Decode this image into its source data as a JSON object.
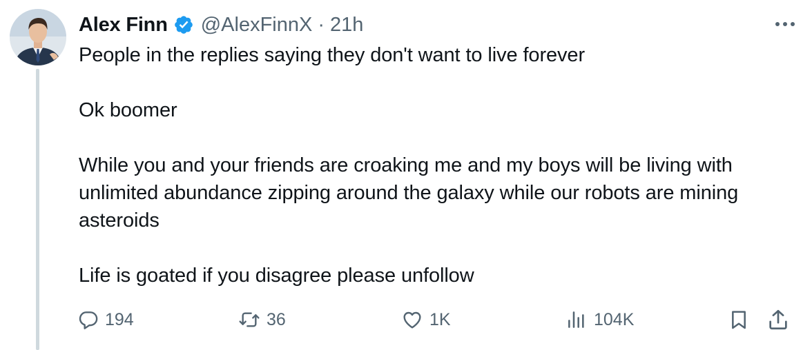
{
  "post": {
    "author": {
      "name": "Alex Finn",
      "handle": "@AlexFinnX",
      "avatar": "profile-photo",
      "verified": true,
      "verified_color": "#1d9bf0"
    },
    "separator": "·",
    "timestamp": "21h",
    "paragraphs": [
      "People in the replies saying they don't want to live forever",
      "Ok boomer",
      "While you and your friends are croaking me and my boys will be living with unlimited abundance zipping around the galaxy while our robots are mining asteroids",
      "Life is goated if you disagree please unfollow"
    ],
    "stats": {
      "replies": "194",
      "reposts": "36",
      "likes": "1K",
      "views": "104K"
    },
    "icons": {
      "more": "more-icon",
      "reply": "reply-icon",
      "repost": "repost-icon",
      "like": "heart-icon",
      "views": "views-icon",
      "bookmark": "bookmark-icon",
      "share": "share-icon"
    },
    "colors": {
      "text": "#0f1419",
      "secondary": "#536471",
      "thread_line": "#cfd9de"
    }
  }
}
